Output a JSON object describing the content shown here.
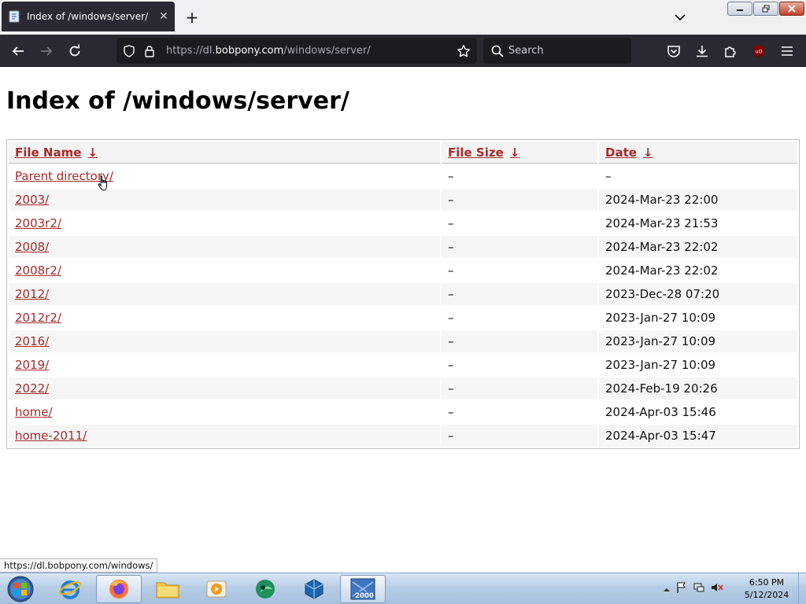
{
  "browser": {
    "tab": {
      "title": "Index of /windows/server/",
      "close_glyph": "✕"
    },
    "new_tab_glyph": "+",
    "url": {
      "prefix": "https://dl.",
      "domain": "bobpony.com",
      "path": "/windows/server/"
    },
    "search_placeholder": "Search",
    "status_link": "https://dl.bobpony.com/windows/",
    "ublock_badge": "uO"
  },
  "page": {
    "heading": "Index of /windows/server/",
    "columns": [
      {
        "label": "File Name",
        "arrow": "↓"
      },
      {
        "label": "File Size",
        "arrow": "↓"
      },
      {
        "label": "Date",
        "arrow": "↓"
      }
    ],
    "rows": [
      {
        "name": "Parent directory/",
        "size": "–",
        "date": "–"
      },
      {
        "name": "2003/",
        "size": "–",
        "date": "2024-Mar-23 22:00"
      },
      {
        "name": "2003r2/",
        "size": "–",
        "date": "2024-Mar-23 21:53"
      },
      {
        "name": "2008/",
        "size": "–",
        "date": "2024-Mar-23 22:02"
      },
      {
        "name": "2008r2/",
        "size": "–",
        "date": "2024-Mar-23 22:02"
      },
      {
        "name": "2012/",
        "size": "–",
        "date": "2023-Dec-28 07:20"
      },
      {
        "name": "2012r2/",
        "size": "–",
        "date": "2023-Jan-27 10:09"
      },
      {
        "name": "2016/",
        "size": "–",
        "date": "2023-Jan-27 10:09"
      },
      {
        "name": "2019/",
        "size": "–",
        "date": "2023-Jan-27 10:09"
      },
      {
        "name": "2022/",
        "size": "–",
        "date": "2024-Feb-19 20:26"
      },
      {
        "name": "home/",
        "size": "–",
        "date": "2024-Apr-03 15:46"
      },
      {
        "name": "home-2011/",
        "size": "–",
        "date": "2024-Apr-03 15:47"
      }
    ]
  },
  "taskbar": {
    "items": [
      "internet-explorer-icon",
      "firefox-icon",
      "file-explorer-icon",
      "media-player-icon",
      "browser-app-icon",
      "virtualbox-icon",
      "windows-2000-icon"
    ],
    "vm_badge": "2000",
    "clock": {
      "time": "6:50 PM",
      "date": "5/12/2024"
    }
  },
  "colors": {
    "link": "#a52a2a",
    "toolbar_bg": "#2b2a33",
    "urlbar_bg": "#1c1b22"
  }
}
